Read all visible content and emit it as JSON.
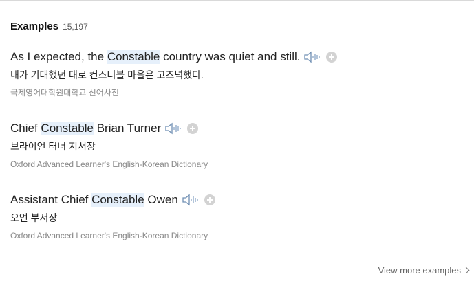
{
  "header": {
    "title": "Examples",
    "count": "15,197"
  },
  "examples": [
    {
      "before": "As I expected, the ",
      "highlight": "Constable",
      "after": " country was quiet and still.",
      "translation": "내가 기대했던 대로 컨스터블 마을은 고즈넉했다.",
      "source": "국제영어대학원대학교 신어사전"
    },
    {
      "before": "Chief ",
      "highlight": "Constable",
      "after": " Brian Turner",
      "translation": "브라이언 터너 지서장",
      "source": "Oxford Advanced Learner's English-Korean Dictionary"
    },
    {
      "before": "Assistant Chief ",
      "highlight": "Constable",
      "after": " Owen",
      "translation": "오언 부서장",
      "source": "Oxford Advanced Learner's English-Korean Dictionary"
    }
  ],
  "footer": {
    "more_label": "View more examples"
  }
}
